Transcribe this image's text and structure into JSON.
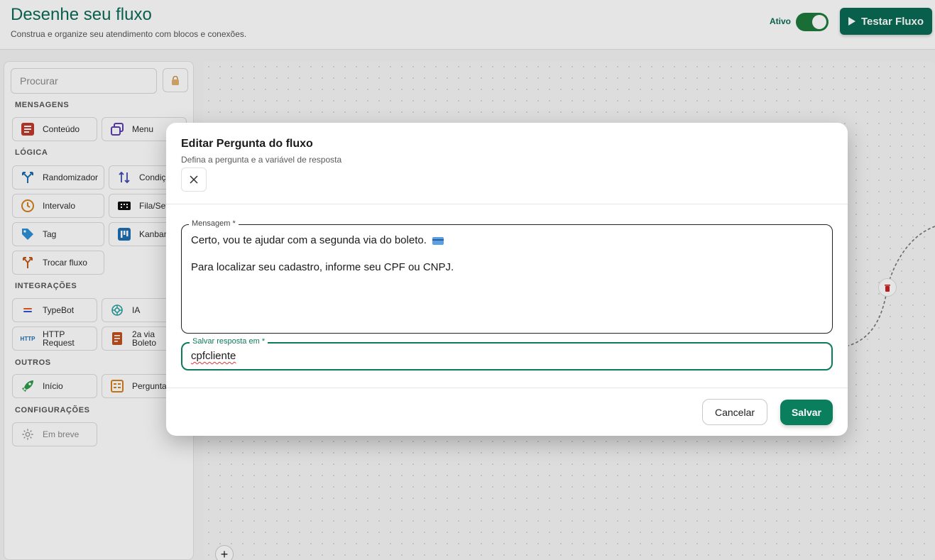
{
  "header": {
    "title": "Desenhe seu fluxo",
    "subtitle": "Construa e organize seu atendimento com blocos e conexões.",
    "active_label": "Ativo",
    "active": true,
    "test_button": "Testar Fluxo"
  },
  "sidebar": {
    "search_placeholder": "Procurar",
    "sections": {
      "mensagens": "MENSAGENS",
      "logica": "LÓGICA",
      "integracoes": "INTEGRAÇÕES",
      "outros": "OUTROS",
      "configuracoes": "CONFIGURAÇÕES"
    },
    "blocks": {
      "conteudo": "Conteúdo",
      "menu": "Menu",
      "randomizador": "Randomizador",
      "condicao": "Condição",
      "intervalo": "Intervalo",
      "fila": "Fila/Setor",
      "tag": "Tag",
      "kanban": "Kanban",
      "trocar_fluxo": "Trocar fluxo",
      "typebot": "TypeBot",
      "ia": "IA",
      "http_request_1": "HTTP",
      "http_request_2": "Request",
      "boleto_1": "2a via",
      "boleto_2": "Boleto",
      "inicio": "Início",
      "pergunta": "Pergunta",
      "em_breve": "Em breve"
    },
    "http_badge": "HTTP"
  },
  "modal": {
    "title": "Editar Pergunta do fluxo",
    "subtitle": "Defina a pergunta e a variável de resposta",
    "message_label": "Mensagem *",
    "message_line1": "Certo, vou te ajudar com a segunda via do boleto.",
    "message_line2": "Para localizar seu cadastro, informe seu CPF ou CNPJ.",
    "variable_label": "Salvar resposta em *",
    "variable_value": "cpfcliente",
    "cancel_label": "Cancelar",
    "save_label": "Salvar"
  },
  "canvas": {
    "add_label": "+"
  },
  "colors": {
    "brand": "#0a6b55",
    "save": "#0a7f5e",
    "toggle_on": "#1e7a3c"
  }
}
